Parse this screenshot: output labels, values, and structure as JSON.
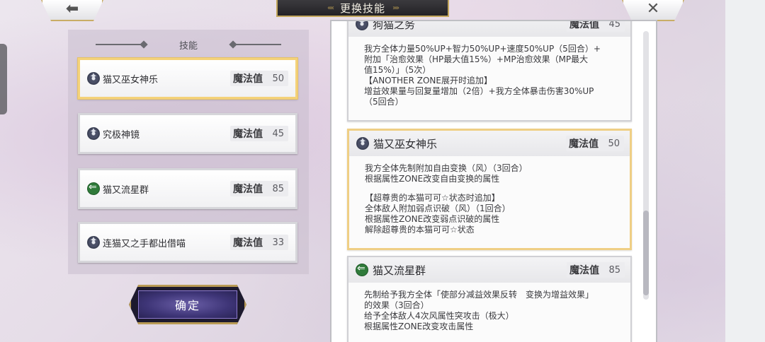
{
  "header": {
    "title": "更换技能",
    "back_icon": "back-arrow-icon",
    "close_icon": "close-x-icon"
  },
  "skill_list": {
    "header_label": "技能",
    "mp_label": "魔法值",
    "items": [
      {
        "name": "猫又巫女神乐",
        "mp": "50",
        "icon": "shuriken-icon",
        "selected": true
      },
      {
        "name": "究极神镜",
        "mp": "45",
        "icon": "shuriken-icon",
        "selected": false
      },
      {
        "name": "猫又流星群",
        "mp": "85",
        "icon": "wind-arrow-icon",
        "selected": false
      },
      {
        "name": "连猫又之手都出借喵",
        "mp": "33",
        "icon": "shuriken-icon",
        "selected": false
      }
    ]
  },
  "confirm_label": "确定",
  "details": {
    "mp_label": "魔法值",
    "cards": [
      {
        "name": "狗猫之务",
        "mp": "45",
        "icon": "shuriken-icon",
        "lines": [
          "我方全体力量50%UP+智力50%UP+速度50%UP（5回合）+",
          "附加「治愈效果（HP最大值15%）+MP治愈效果（MP最大",
          "值15%）」（5次）",
          "【ANOTHER ZONE展开时追加】",
          "增益效果量与回复量增加（2倍）+我方全体暴击伤害30%UP",
          "（5回合）"
        ]
      },
      {
        "name": "猫又巫女神乐",
        "mp": "50",
        "icon": "shuriken-icon",
        "lines": [
          "我方全体先制附加自由变换（风）（3回合）",
          "根据属性ZONE改变自由变换的属性",
          "",
          "【超尊贵的本猫可可☆状态时追加】",
          "全体敌人附加弱点识破（风）（1回合）",
          "根据属性ZONE改变弱点识破的属性",
          "解除超尊贵的本猫可可☆状态"
        ]
      },
      {
        "name": "猫又流星群",
        "mp": "85",
        "icon": "wind-arrow-icon",
        "lines": [
          "先制给予我方全体「使部分减益效果反转　变换为增益效果」",
          "的效果（3回合）",
          "给予全体敌人4次风属性突攻击（极大）",
          "根据属性ZONE改变攻击属性"
        ]
      }
    ]
  }
}
